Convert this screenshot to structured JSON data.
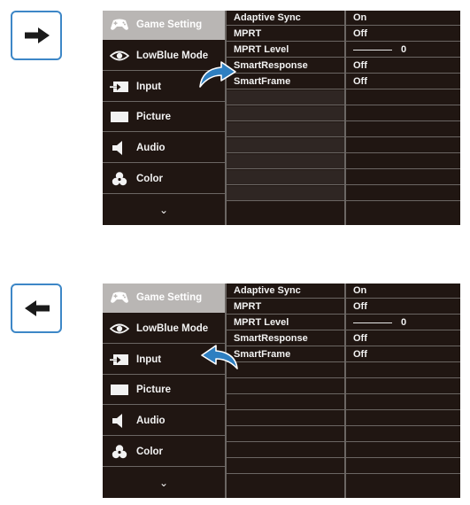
{
  "colors": {
    "osd_bg": "#201612",
    "selected_bg": "#b9b6b4",
    "divider": "#6b6663",
    "accent_blue": "#2e7fc1",
    "button_border": "#3d87c7"
  },
  "panels": [
    {
      "nav_button": {
        "direction": "right",
        "icon": "arrow-right-icon"
      },
      "callout": {
        "icon": "curved-arrow-right-icon"
      },
      "menu": {
        "items": [
          {
            "label": "Game Setting",
            "icon": "gamepad-icon",
            "selected": true
          },
          {
            "label": "LowBlue Mode",
            "icon": "eye-icon",
            "selected": false
          },
          {
            "label": "Input",
            "icon": "input-icon",
            "selected": false
          },
          {
            "label": "Picture",
            "icon": "picture-icon",
            "selected": false
          },
          {
            "label": "Audio",
            "icon": "speaker-icon",
            "selected": false
          },
          {
            "label": "Color",
            "icon": "color-icon",
            "selected": false
          }
        ],
        "more": "⌄"
      },
      "submenu": [
        {
          "name": "Adaptive Sync",
          "value": "On"
        },
        {
          "name": "MPRT",
          "value": "Off"
        },
        {
          "name": "MPRT Level",
          "value": "0",
          "slider": true
        },
        {
          "name": "SmartResponse",
          "value": "Off"
        },
        {
          "name": "SmartFrame",
          "value": "Off"
        }
      ]
    },
    {
      "nav_button": {
        "direction": "left",
        "icon": "arrow-left-icon"
      },
      "callout": {
        "icon": "curved-arrow-left-icon"
      },
      "menu": {
        "items": [
          {
            "label": "Game Setting",
            "icon": "gamepad-icon",
            "selected": true
          },
          {
            "label": "LowBlue Mode",
            "icon": "eye-icon",
            "selected": false
          },
          {
            "label": "Input",
            "icon": "input-icon",
            "selected": false
          },
          {
            "label": "Picture",
            "icon": "picture-icon",
            "selected": false
          },
          {
            "label": "Audio",
            "icon": "speaker-icon",
            "selected": false
          },
          {
            "label": "Color",
            "icon": "color-icon",
            "selected": false
          }
        ],
        "more": "⌄"
      },
      "submenu": [
        {
          "name": "Adaptive Sync",
          "value": "On"
        },
        {
          "name": "MPRT",
          "value": "Off"
        },
        {
          "name": "MPRT Level",
          "value": "0",
          "slider": true
        },
        {
          "name": "SmartResponse",
          "value": "Off"
        },
        {
          "name": "SmartFrame",
          "value": "Off"
        }
      ]
    }
  ]
}
